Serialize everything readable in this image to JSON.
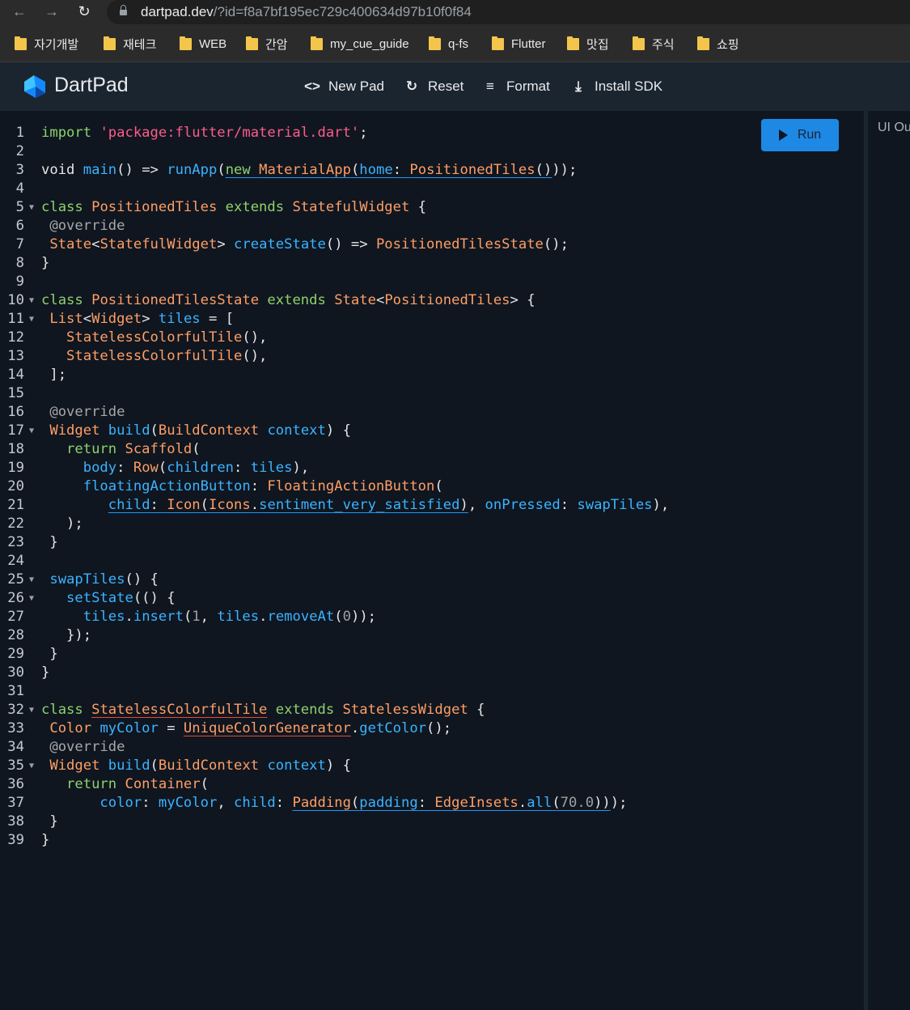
{
  "browser": {
    "url_host": "dartpad.dev",
    "url_rest": "/?id=f8a7bf195ec729c400634d97b10f0f84",
    "bookmarks": [
      "자기개발",
      "재테크",
      "WEB",
      "간암",
      "my_cue_guide",
      "q-fs",
      "Flutter",
      "맛집",
      "주식",
      "쇼핑"
    ]
  },
  "header": {
    "brand": "DartPad",
    "new_pad": "New Pad",
    "reset": "Reset",
    "format": "Format",
    "install_sdk": "Install SDK"
  },
  "run_label": "Run",
  "ui_output_label": "UI Ou",
  "code": {
    "l1": [
      [
        "kw",
        "import "
      ],
      [
        "str",
        "'package:flutter/material.dart'"
      ],
      [
        "p",
        ";"
      ]
    ],
    "l2": [],
    "l3": [
      [
        "p",
        "void "
      ],
      [
        "fn",
        "main"
      ],
      [
        "p",
        "() => "
      ],
      [
        "fn",
        "runApp"
      ],
      [
        "p",
        "("
      ],
      [
        "kw ub",
        "new "
      ],
      [
        "ty ub",
        "MaterialApp"
      ],
      [
        "p ub",
        "("
      ],
      [
        "fn ub",
        "home"
      ],
      [
        "p ub",
        ": "
      ],
      [
        "ty ub",
        "PositionedTiles"
      ],
      [
        "p ub",
        "()"
      ],
      [
        "p",
        "));"
      ]
    ],
    "l4": [],
    "l5": [
      [
        "kw",
        "class "
      ],
      [
        "ty",
        "PositionedTiles"
      ],
      [
        "kw",
        " extends "
      ],
      [
        "ty",
        "StatefulWidget"
      ],
      [
        "p",
        " {"
      ]
    ],
    "l6": [
      [
        "ann",
        " @override"
      ]
    ],
    "l7": [
      [
        "ty",
        " State"
      ],
      [
        "p",
        "<"
      ],
      [
        "ty",
        "StatefulWidget"
      ],
      [
        "p",
        "> "
      ],
      [
        "fn",
        "createState"
      ],
      [
        "p",
        "() => "
      ],
      [
        "ty",
        "PositionedTilesState"
      ],
      [
        "p",
        "();"
      ]
    ],
    "l8": [
      [
        "p",
        "}"
      ]
    ],
    "l9": [],
    "l10": [
      [
        "kw",
        "class "
      ],
      [
        "ty",
        "PositionedTilesState"
      ],
      [
        "kw",
        " extends "
      ],
      [
        "ty",
        "State"
      ],
      [
        "p",
        "<"
      ],
      [
        "ty",
        "PositionedTiles"
      ],
      [
        "p",
        "> {"
      ]
    ],
    "l11": [
      [
        "ty",
        " List"
      ],
      [
        "p",
        "<"
      ],
      [
        "ty",
        "Widget"
      ],
      [
        "p",
        "> "
      ],
      [
        "fn",
        "tiles"
      ],
      [
        "p",
        " = ["
      ]
    ],
    "l12": [
      [
        "ty",
        "   StatelessColorfulTile"
      ],
      [
        "p",
        "(),"
      ]
    ],
    "l13": [
      [
        "ty",
        "   StatelessColorfulTile"
      ],
      [
        "p",
        "(),"
      ]
    ],
    "l14": [
      [
        "p",
        " ];"
      ]
    ],
    "l15": [],
    "l16": [
      [
        "ann",
        " @override"
      ]
    ],
    "l17": [
      [
        "ty",
        " Widget "
      ],
      [
        "fn",
        "build"
      ],
      [
        "p",
        "("
      ],
      [
        "ty",
        "BuildContext"
      ],
      [
        "fn",
        " context"
      ],
      [
        "p",
        ") {"
      ]
    ],
    "l18": [
      [
        "kw",
        "   return "
      ],
      [
        "ty",
        "Scaffold"
      ],
      [
        "p",
        "("
      ]
    ],
    "l19": [
      [
        "fn",
        "     body"
      ],
      [
        "p",
        ": "
      ],
      [
        "ty",
        "Row"
      ],
      [
        "p",
        "("
      ],
      [
        "fn",
        "children"
      ],
      [
        "p",
        ": "
      ],
      [
        "fn",
        "tiles"
      ],
      [
        "p",
        "),"
      ]
    ],
    "l20": [
      [
        "fn",
        "     floatingActionButton"
      ],
      [
        "p",
        ": "
      ],
      [
        "ty",
        "FloatingActionButton"
      ],
      [
        "p",
        "("
      ]
    ],
    "l21": [
      [
        "p",
        "        "
      ],
      [
        "fn ub",
        "child"
      ],
      [
        "p ub",
        ": "
      ],
      [
        "ty ub",
        "Icon"
      ],
      [
        "p ub",
        "("
      ],
      [
        "ty ub",
        "Icons"
      ],
      [
        "p ub",
        "."
      ],
      [
        "fn ub",
        "sentiment_very_satisfied"
      ],
      [
        "p ub",
        ")"
      ],
      [
        "p",
        ", "
      ],
      [
        "fn",
        "onPressed"
      ],
      [
        "p",
        ": "
      ],
      [
        "fn",
        "swapTiles"
      ],
      [
        "p",
        "),"
      ]
    ],
    "l22": [
      [
        "p",
        "   );"
      ]
    ],
    "l23": [
      [
        "p",
        " }"
      ]
    ],
    "l24": [],
    "l25": [
      [
        "fn",
        " swapTiles"
      ],
      [
        "p",
        "() {"
      ]
    ],
    "l26": [
      [
        "fn",
        "   setState"
      ],
      [
        "p",
        "(() {"
      ]
    ],
    "l27": [
      [
        "fn",
        "     tiles"
      ],
      [
        "p",
        "."
      ],
      [
        "fn",
        "insert"
      ],
      [
        "p",
        "("
      ],
      [
        "num",
        "1"
      ],
      [
        "p",
        ", "
      ],
      [
        "fn",
        "tiles"
      ],
      [
        "p",
        "."
      ],
      [
        "fn",
        "removeAt"
      ],
      [
        "p",
        "("
      ],
      [
        "num",
        "0"
      ],
      [
        "p",
        "));"
      ]
    ],
    "l28": [
      [
        "p",
        "   });"
      ]
    ],
    "l29": [
      [
        "p",
        " }"
      ]
    ],
    "l30": [
      [
        "p",
        "}"
      ]
    ],
    "l31": [],
    "l32": [
      [
        "kw",
        "class "
      ],
      [
        "ty ur",
        "StatelessColorfulTile"
      ],
      [
        "kw",
        " extends "
      ],
      [
        "ty",
        "StatelessWidget"
      ],
      [
        "p",
        " {"
      ]
    ],
    "l33": [
      [
        "ty",
        " Color "
      ],
      [
        "fn",
        "myColor"
      ],
      [
        "p",
        " = "
      ],
      [
        "ty ur",
        "UniqueColorGenerator"
      ],
      [
        "p",
        "."
      ],
      [
        "fn",
        "getColor"
      ],
      [
        "p",
        "();"
      ]
    ],
    "l34": [
      [
        "ann",
        " @override"
      ]
    ],
    "l35": [
      [
        "ty",
        " Widget "
      ],
      [
        "fn",
        "build"
      ],
      [
        "p",
        "("
      ],
      [
        "ty",
        "BuildContext"
      ],
      [
        "fn",
        " context"
      ],
      [
        "p",
        ") {"
      ]
    ],
    "l36": [
      [
        "kw",
        "   return "
      ],
      [
        "ty",
        "Container"
      ],
      [
        "p",
        "("
      ]
    ],
    "l37": [
      [
        "fn",
        "       color"
      ],
      [
        "p",
        ": "
      ],
      [
        "fn",
        "myColor"
      ],
      [
        "p",
        ", "
      ],
      [
        "fn",
        "child"
      ],
      [
        "p",
        ": "
      ],
      [
        "ty ub",
        "Padding"
      ],
      [
        "p ub",
        "("
      ],
      [
        "fn ub",
        "padding"
      ],
      [
        "p ub",
        ": "
      ],
      [
        "ty ub",
        "EdgeInsets"
      ],
      [
        "p ub",
        "."
      ],
      [
        "fn ub",
        "all"
      ],
      [
        "p ub",
        "("
      ],
      [
        "num ub",
        "70.0"
      ],
      [
        "p ub",
        "))"
      ],
      [
        "p",
        ");"
      ]
    ],
    "l38": [
      [
        "p",
        " }"
      ]
    ],
    "l39": [
      [
        "p",
        "}"
      ]
    ]
  },
  "fold_lines": [
    5,
    10,
    11,
    17,
    25,
    26,
    32,
    35
  ]
}
